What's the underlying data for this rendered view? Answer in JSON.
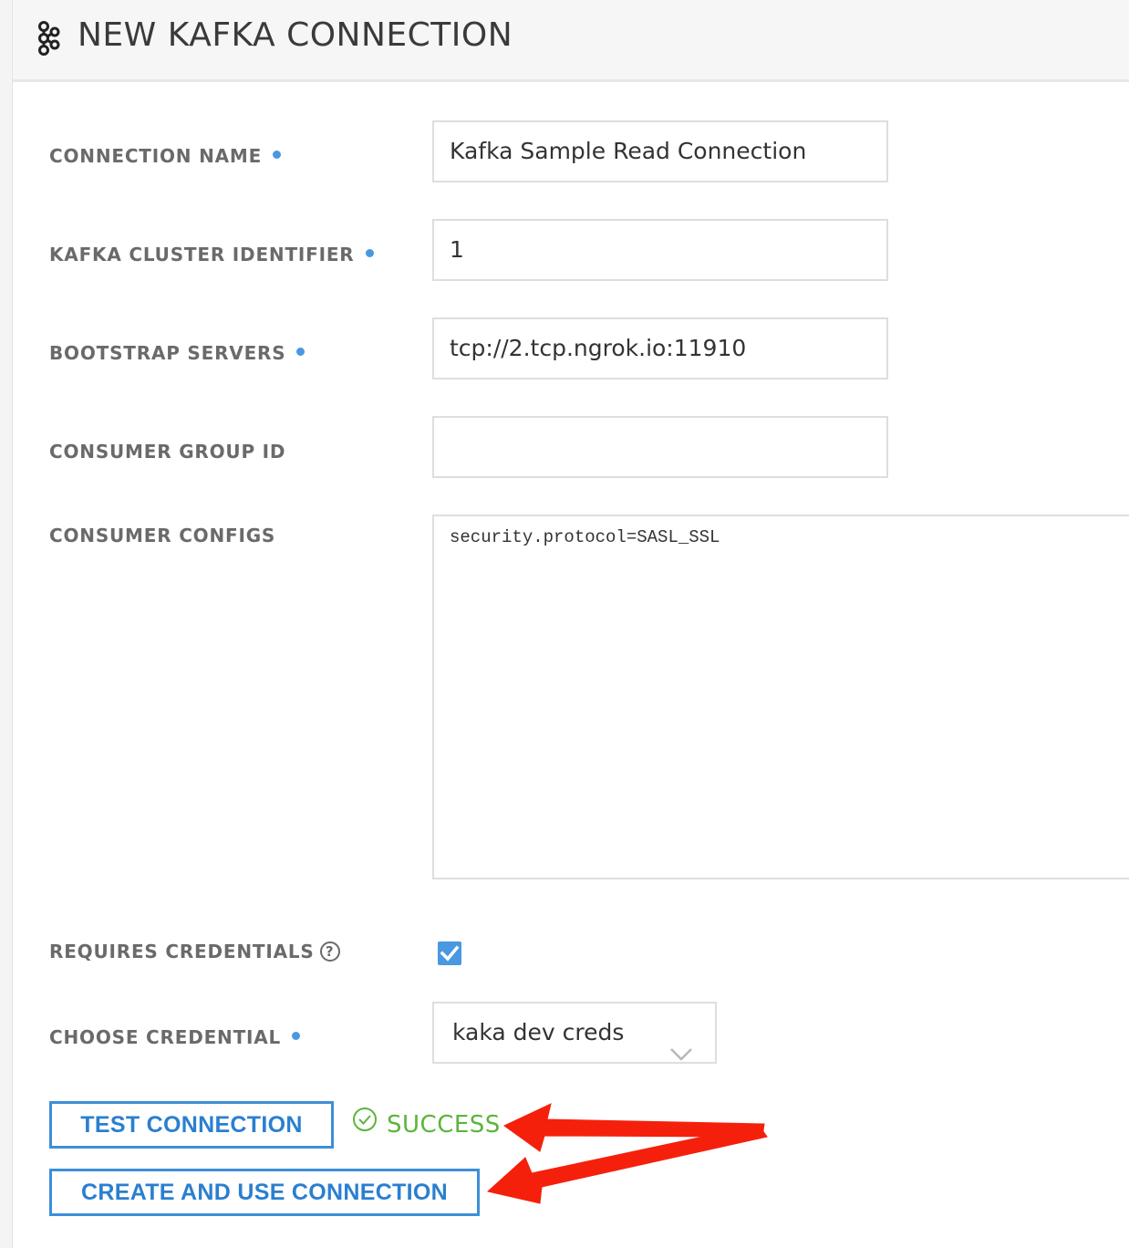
{
  "header": {
    "title": "NEW KAFKA CONNECTION",
    "icon": "kafka-icon"
  },
  "form": {
    "connection_name": {
      "label": "CONNECTION NAME",
      "value": "Kafka Sample Read Connection",
      "required": true
    },
    "cluster_identifier": {
      "label": "KAFKA CLUSTER IDENTIFIER",
      "value": "1",
      "required": true
    },
    "bootstrap_servers": {
      "label": "BOOTSTRAP SERVERS",
      "value": "tcp://2.tcp.ngrok.io:11910",
      "required": true
    },
    "consumer_group_id": {
      "label": "CONSUMER GROUP ID",
      "value": "",
      "required": false
    },
    "consumer_configs": {
      "label": "CONSUMER CONFIGS",
      "value": "security.protocol=SASL_SSL"
    },
    "requires_credentials": {
      "label": "REQUIRES CREDENTIALS",
      "help_icon": "?",
      "checked": true
    },
    "choose_credential": {
      "label": "CHOOSE CREDENTIAL",
      "value": "kaka dev creds",
      "required": true
    }
  },
  "actions": {
    "test_label": "TEST CONNECTION",
    "status_text": "SUCCESS",
    "create_label": "CREATE AND USE CONNECTION"
  },
  "colors": {
    "accent": "#3d8fd8",
    "required_dot": "#4a98e0",
    "success": "#5bb53b",
    "annotation_arrow": "#f5200c"
  }
}
